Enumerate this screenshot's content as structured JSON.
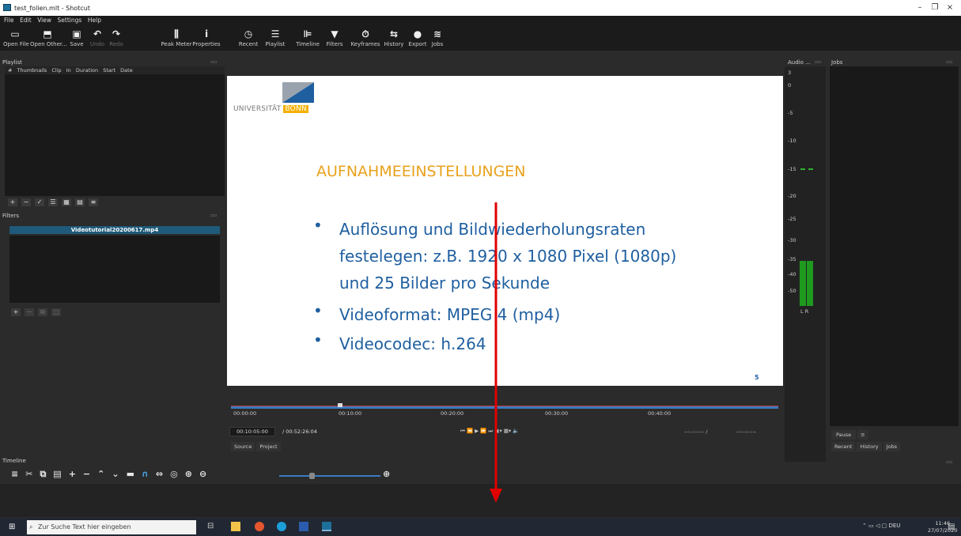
{
  "window": {
    "title": "test_folien.mlt - Shotcut"
  },
  "menu": [
    "File",
    "Edit",
    "View",
    "Settings",
    "Help"
  ],
  "toolbar": [
    {
      "label": "Open File",
      "icon": "folder-icon"
    },
    {
      "label": "Open Other...",
      "icon": "open-other-icon"
    },
    {
      "label": "Save",
      "icon": "save-icon"
    },
    {
      "label": "Undo",
      "icon": "undo-icon"
    },
    {
      "label": "Redo",
      "icon": "redo-icon"
    },
    {
      "label": "Peak Meter",
      "icon": "peak-meter-icon"
    },
    {
      "label": "Properties",
      "icon": "info-icon"
    },
    {
      "label": "Recent",
      "icon": "clock-icon"
    },
    {
      "label": "Playlist",
      "icon": "list-icon"
    },
    {
      "label": "Timeline",
      "icon": "timeline-icon"
    },
    {
      "label": "Filters",
      "icon": "funnel-icon"
    },
    {
      "label": "Keyframes",
      "icon": "stopwatch-icon"
    },
    {
      "label": "History",
      "icon": "history-icon"
    },
    {
      "label": "Export",
      "icon": "export-icon"
    },
    {
      "label": "Jobs",
      "icon": "jobs-icon"
    }
  ],
  "playlist": {
    "title": "Playlist",
    "columns": [
      "#",
      "Thumbnails",
      "Clip",
      "In",
      "Duration",
      "Start",
      "Date"
    ]
  },
  "filters": {
    "title": "Filters",
    "selected_clip": "Videotutorial20200617.mp4"
  },
  "slide": {
    "university": "UNIVERSITÄT",
    "university_city": "BONN",
    "heading": "AUFNAHMEEINSTELLUNGEN",
    "bullets": [
      [
        "Auflösung und Bildwiederholungsraten",
        "festelegen: z.B. 1920 x 1080 Pixel (1080p)",
        "und 25 Bilder pro Sekunde"
      ],
      [
        "Videoformat: MPEG 4 (mp4)"
      ],
      [
        "Videocodec: h.264"
      ]
    ],
    "page_number": "5"
  },
  "ruler": {
    "ticks": [
      "00:00:00",
      "00:10:00",
      "00:20:00",
      "00:30:00",
      "00:40:00"
    ]
  },
  "player": {
    "current_time": "00:10:05:00",
    "total_time": "/ 00:52:26:04",
    "in_point": "--:--:--:-- /",
    "out_point": "--:--:--:--",
    "tabs": [
      "Source",
      "Project"
    ]
  },
  "audio": {
    "title": "Audio ...",
    "scale": [
      "3",
      "0",
      "-5",
      "-10",
      "-15",
      "-20",
      "-25",
      "-30",
      "-35",
      "-40",
      "-50"
    ],
    "channels": "L R"
  },
  "jobs": {
    "title": "Jobs",
    "pause_label": "Pause",
    "tabs": [
      "Recent",
      "History",
      "Jobs"
    ]
  },
  "timeline": {
    "title": "Timeline"
  },
  "taskbar": {
    "search_placeholder": "Zur Suche Text hier eingeben",
    "language": "DEU",
    "time": "11:46",
    "date": "27/07/2020"
  }
}
